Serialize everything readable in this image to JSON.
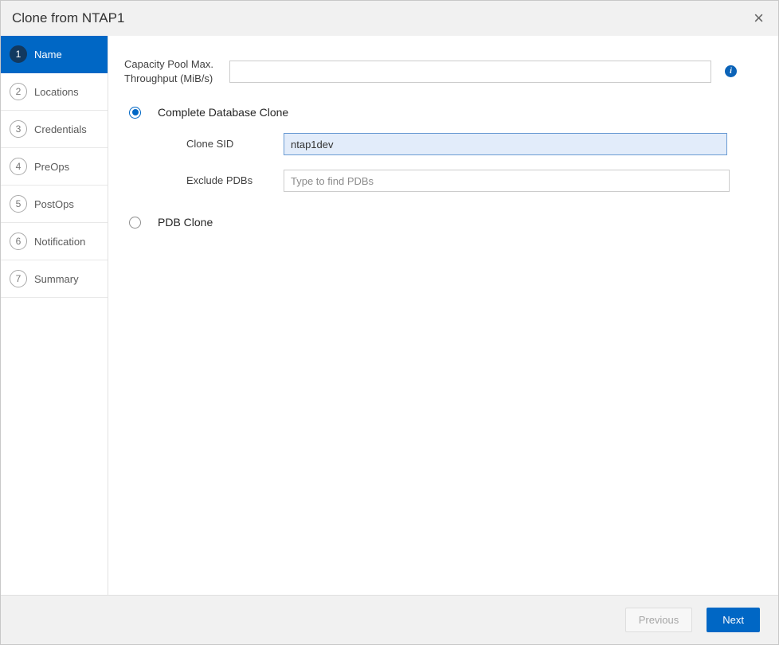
{
  "window": {
    "title": "Clone from NTAP1",
    "close_icon": "×"
  },
  "sidebar": {
    "items": [
      {
        "number": "1",
        "label": "Name",
        "active": true
      },
      {
        "number": "2",
        "label": "Locations",
        "active": false
      },
      {
        "number": "3",
        "label": "Credentials",
        "active": false
      },
      {
        "number": "4",
        "label": "PreOps",
        "active": false
      },
      {
        "number": "5",
        "label": "PostOps",
        "active": false
      },
      {
        "number": "6",
        "label": "Notification",
        "active": false
      },
      {
        "number": "7",
        "label": "Summary",
        "active": false
      }
    ]
  },
  "main": {
    "capacity_pool": {
      "label": "Capacity Pool Max. Throughput (MiB/s)",
      "value": "",
      "info_icon": "i"
    },
    "complete_clone": {
      "label": "Complete Database Clone",
      "selected": true
    },
    "clone_sid": {
      "label": "Clone SID",
      "value": "ntap1dev"
    },
    "exclude_pdbs": {
      "label": "Exclude PDBs",
      "placeholder": "Type to find PDBs"
    },
    "pdb_clone": {
      "label": "PDB Clone",
      "selected": false
    }
  },
  "footer": {
    "previous_label": "Previous",
    "next_label": "Next"
  },
  "colors": {
    "accent_blue": "#0067c5",
    "active_step_circle": "#12395f",
    "header_bg": "#f1f1f1",
    "sid_input_bg": "#e2ecfa",
    "sid_input_border": "#6a9bd3"
  }
}
